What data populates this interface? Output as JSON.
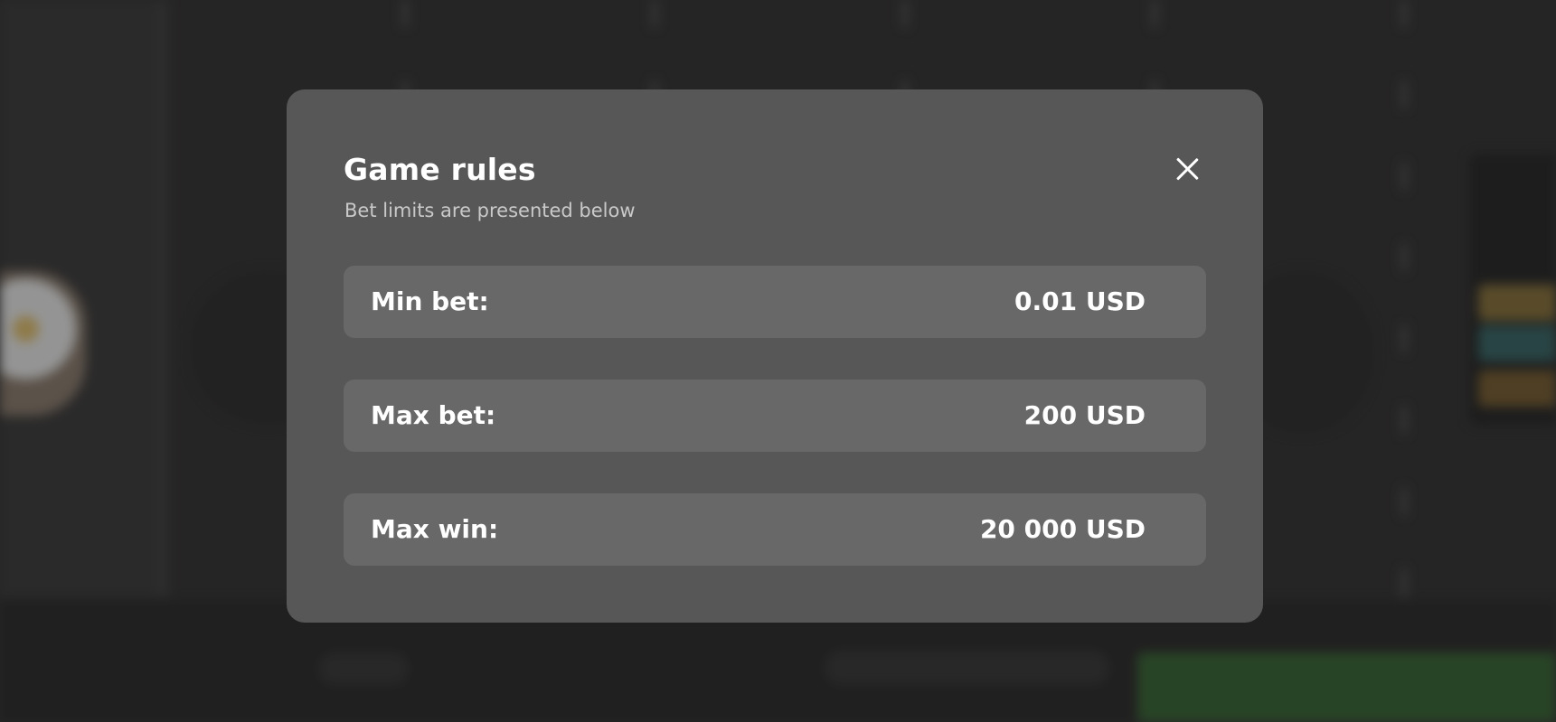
{
  "modal": {
    "title": "Game rules",
    "subtitle": "Bet limits are presented below",
    "close_icon": "close-icon",
    "limits": [
      {
        "label": "Min bet:",
        "value": "0.01 USD"
      },
      {
        "label": "Max bet:",
        "value": "200 USD"
      },
      {
        "label": "Max win:",
        "value": "20 000 USD"
      }
    ]
  },
  "colors": {
    "backdrop": "#2b2a2a",
    "modal_background": "#575757",
    "row_background": "#686868",
    "title_text": "#ffffff",
    "subtitle_text": "#c9c9c9"
  }
}
